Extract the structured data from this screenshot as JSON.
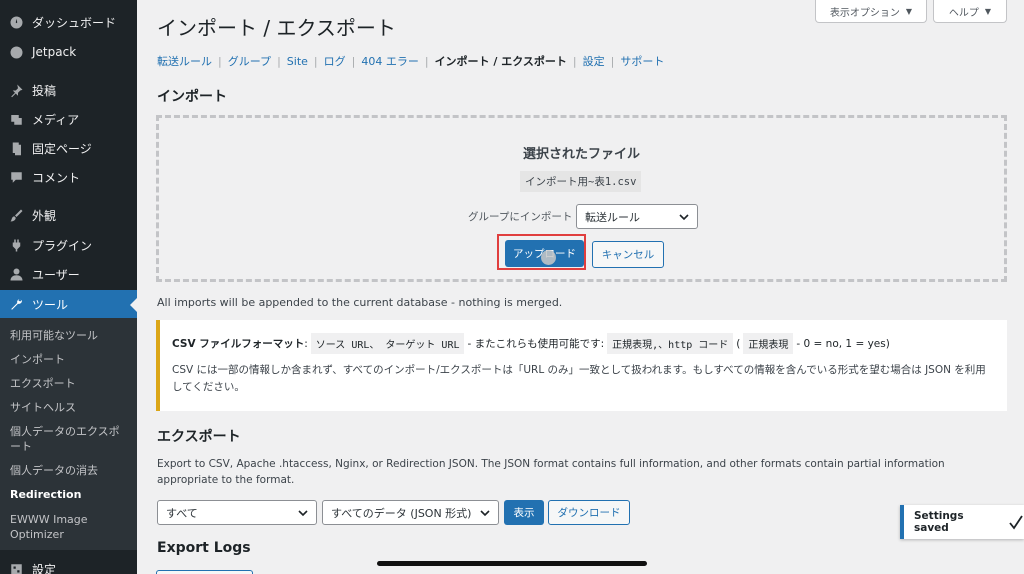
{
  "sidebar": {
    "items": [
      {
        "label": "ダッシュボード",
        "icon": "dashboard-icon"
      },
      {
        "label": "Jetpack",
        "icon": "jetpack-icon"
      },
      {
        "label": "投稿",
        "icon": "pin-icon"
      },
      {
        "label": "メディア",
        "icon": "media-icon"
      },
      {
        "label": "固定ページ",
        "icon": "page-icon"
      },
      {
        "label": "コメント",
        "icon": "comment-icon"
      },
      {
        "label": "外観",
        "icon": "brush-icon"
      },
      {
        "label": "プラグイン",
        "icon": "plugin-icon"
      },
      {
        "label": "ユーザー",
        "icon": "user-icon"
      },
      {
        "label": "ツール",
        "icon": "wrench-icon"
      },
      {
        "label": "設定",
        "icon": "settings-icon"
      }
    ],
    "submenu": [
      "利用可能なツール",
      "インポート",
      "エクスポート",
      "サイトヘルス",
      "個人データのエクスポート",
      "個人データの消去",
      "Redirection",
      "EWWW Image Optimizer"
    ]
  },
  "header": {
    "screen_options": "表示オプション",
    "help": "ヘルプ",
    "title": "インポート / エクスポート"
  },
  "tabs": [
    "転送ルール",
    "グループ",
    "Site",
    "ログ",
    "404 エラー",
    "インポート / エクスポート",
    "設定",
    "サポート"
  ],
  "import": {
    "heading": "インポート",
    "selected_title": "選択されたファイル",
    "filename": "インポート用~表1.csv",
    "group_label": "グループにインポート",
    "group_value": "転送ルール",
    "upload": "アップロード",
    "cancel": "キャンセル",
    "note": "All imports will be appended to the current database - nothing is merged."
  },
  "notice": {
    "bold_label": "CSV ファイルフォーマット",
    "colon": ":",
    "code_source": "ソース URL、 ターゲット URL",
    "mid_text": "- またこれらも使用可能です:",
    "code_regex": "正規表現,、http コード",
    "paren_open": "(",
    "code_regex2": "正規表現",
    "tail_text": "- 0 = no, 1 = yes)",
    "line2": "CSV には一部の情報しか含まれず、すべてのインポート/エクスポートは「URL のみ」一致として扱われます。もしすべての情報を含んでいる形式を望む場合は JSON を利用してください。"
  },
  "export": {
    "heading": "エクスポート",
    "desc": "Export to CSV, Apache .htaccess, Nginx, or Redirection JSON. The JSON format contains full information, and other formats contain partial information appropriate to the format.",
    "select1": "すべて",
    "select2": "すべてのデータ (JSON 形式)",
    "view": "表示",
    "download": "ダウンロード"
  },
  "logs": {
    "heading": "Export Logs"
  },
  "toast": {
    "text": "Settings saved"
  },
  "colors": {
    "accent": "#2271b1",
    "sidebar": "#1d2327",
    "warning": "#dba617",
    "highlight": "#e03e3e"
  }
}
